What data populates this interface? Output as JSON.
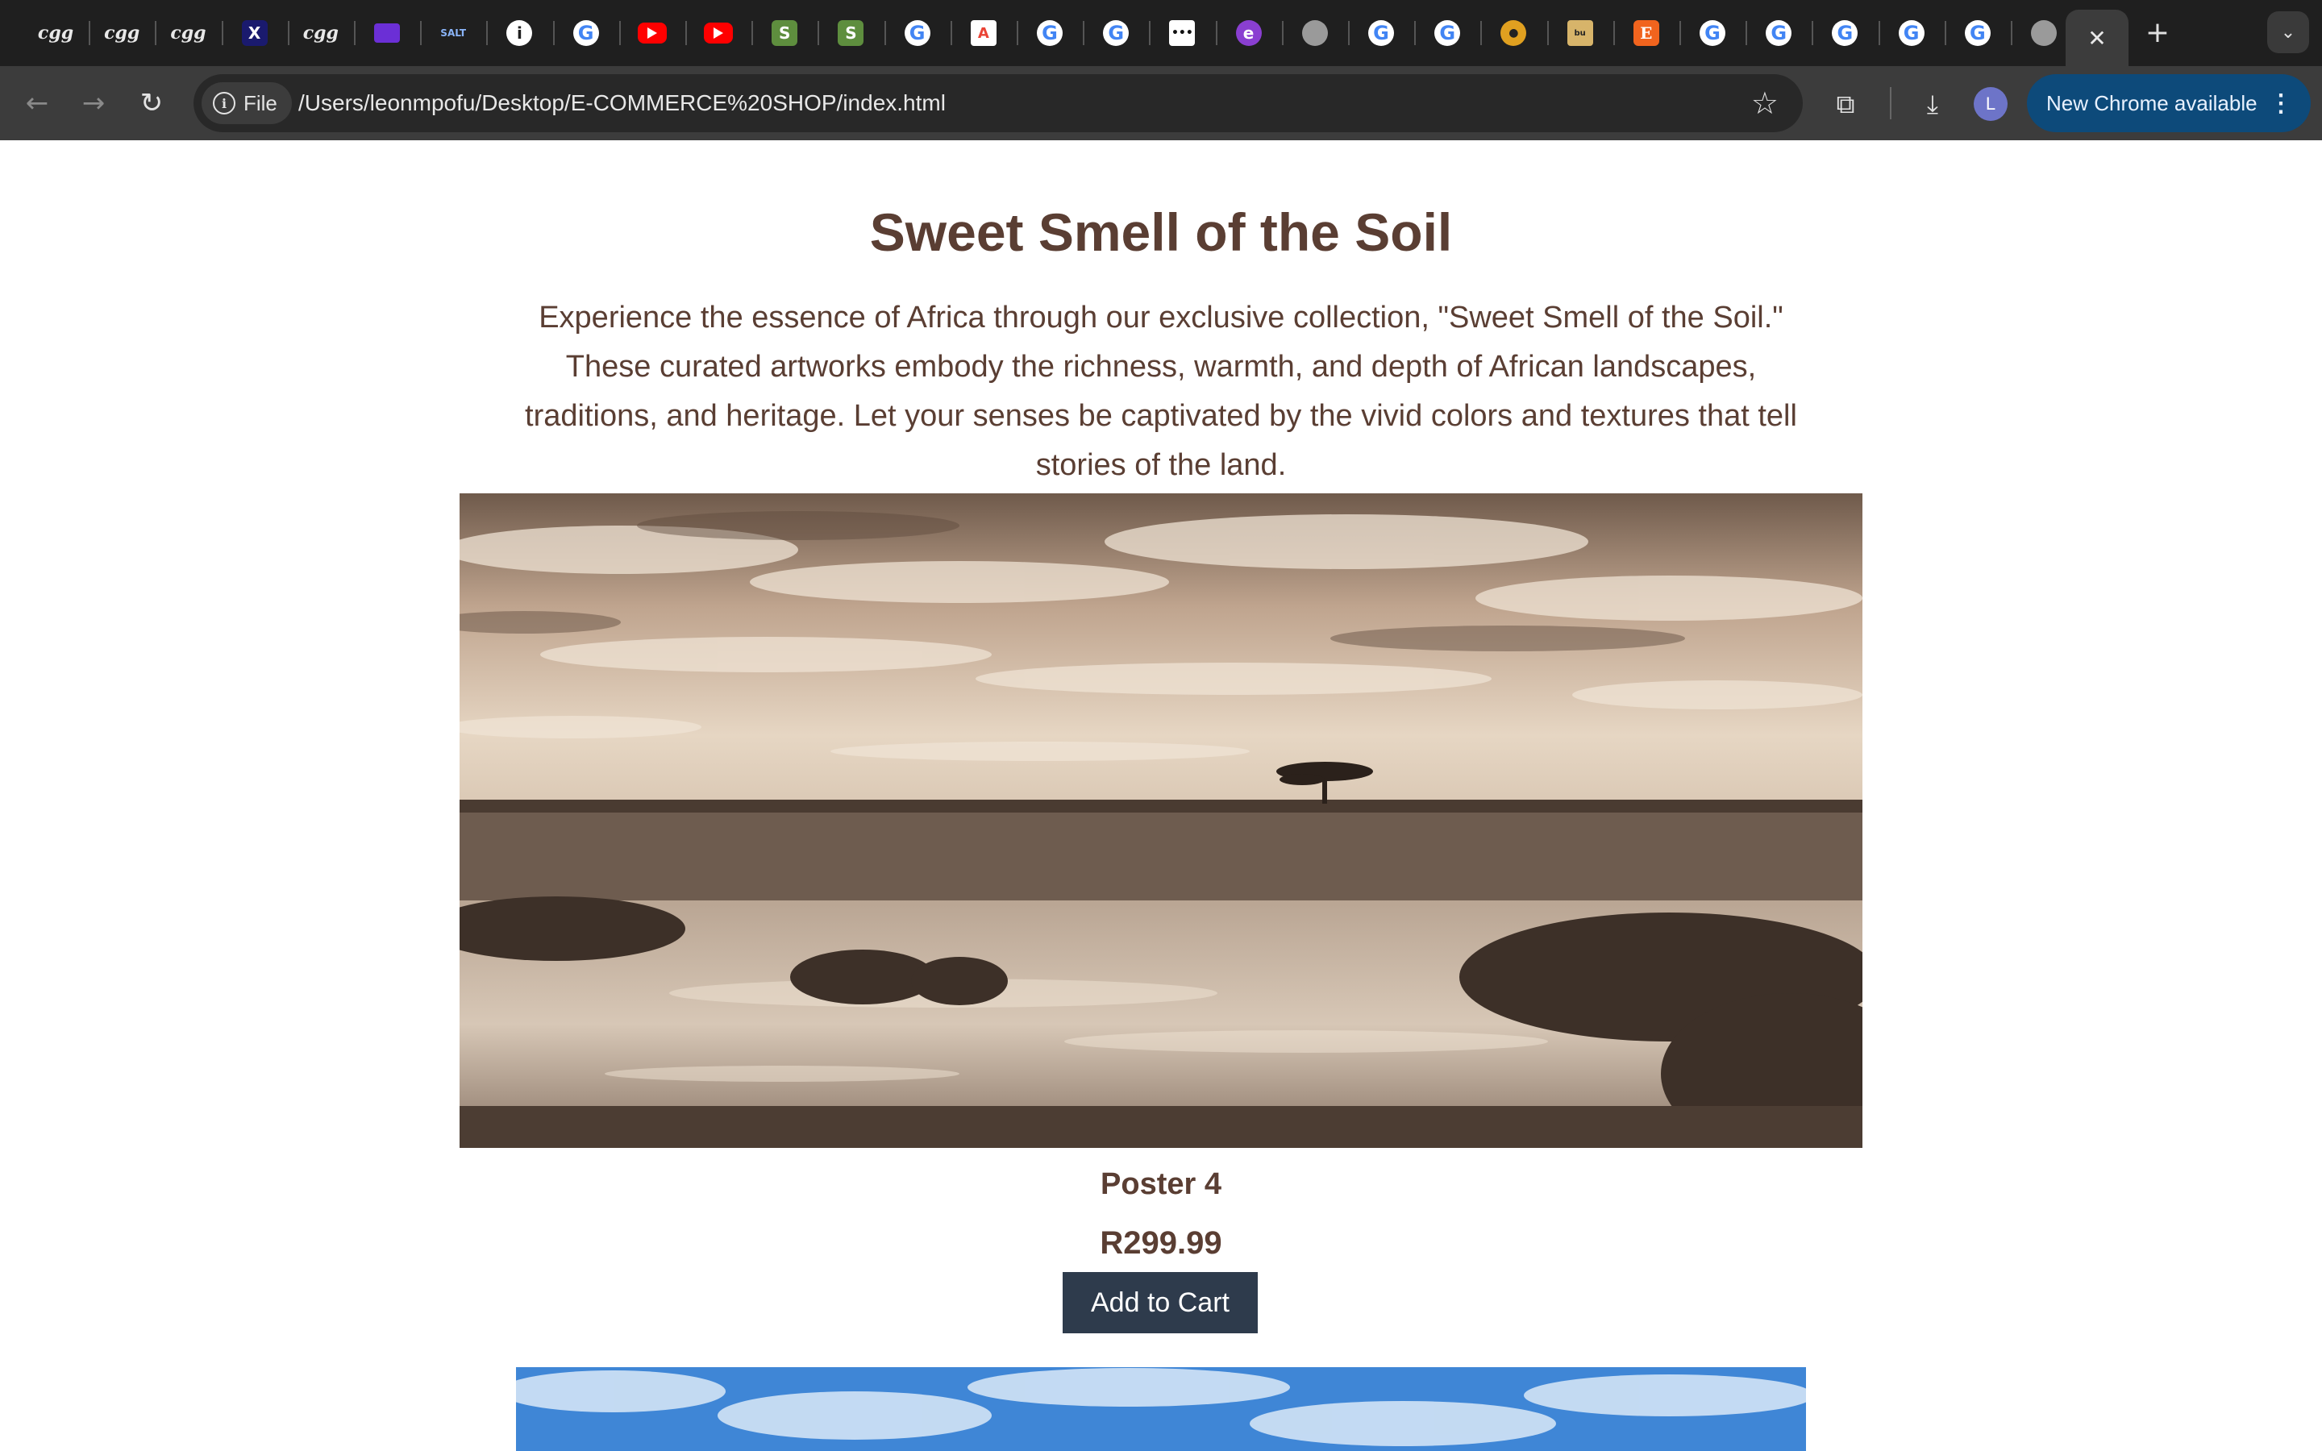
{
  "browser": {
    "tabs": [
      {
        "icon": "cgg-icon",
        "glyph": "cgg"
      },
      {
        "icon": "cgg-icon",
        "glyph": "cgg"
      },
      {
        "icon": "cgg-icon",
        "glyph": "cgg"
      },
      {
        "icon": "x-icon",
        "glyph": "X"
      },
      {
        "icon": "cgg-icon",
        "glyph": "cgg"
      },
      {
        "icon": "mail-icon",
        "glyph": ""
      },
      {
        "icon": "salt-icon",
        "glyph": "SALT"
      },
      {
        "icon": "info-icon",
        "glyph": "i"
      },
      {
        "icon": "google-icon",
        "glyph": "G"
      },
      {
        "icon": "youtube-icon",
        "glyph": ""
      },
      {
        "icon": "youtube-icon",
        "glyph": ""
      },
      {
        "icon": "shopify-icon",
        "glyph": "S"
      },
      {
        "icon": "shopify-icon",
        "glyph": "S"
      },
      {
        "icon": "google-icon",
        "glyph": "G"
      },
      {
        "icon": "ms-icon",
        "glyph": "A"
      },
      {
        "icon": "google-icon",
        "glyph": "G"
      },
      {
        "icon": "google-icon",
        "glyph": "G"
      },
      {
        "icon": "dots-icon",
        "glyph": "•••"
      },
      {
        "icon": "purple-icon",
        "glyph": "e"
      },
      {
        "icon": "globe-icon",
        "glyph": ""
      },
      {
        "icon": "google-icon",
        "glyph": "G"
      },
      {
        "icon": "google-icon",
        "glyph": "G"
      },
      {
        "icon": "amber-icon",
        "glyph": "●"
      },
      {
        "icon": "doc-icon",
        "glyph": "bu"
      },
      {
        "icon": "etsy-icon",
        "glyph": "E"
      },
      {
        "icon": "google-icon",
        "glyph": "G"
      },
      {
        "icon": "google-icon",
        "glyph": "G"
      },
      {
        "icon": "google-icon",
        "glyph": "G"
      },
      {
        "icon": "google-icon",
        "glyph": "G"
      },
      {
        "icon": "google-icon",
        "glyph": "G"
      },
      {
        "icon": "globe-icon",
        "glyph": ""
      }
    ],
    "active_tab_close": "✕",
    "new_tab": "+",
    "tab_menu": "⌄",
    "back": "←",
    "forward": "→",
    "reload": "↻",
    "chip_label": "File",
    "url": "/Users/leonmpofu/Desktop/E-COMMERCE%20SHOP/index.html",
    "bookmark_star": "☆",
    "extensions": "⧉",
    "download": "⤓",
    "avatar_letter": "L",
    "update_label": "New Chrome available",
    "update_menu": "⋮"
  },
  "page": {
    "title": "Sweet Smell of the Soil",
    "intro": "Experience the essence of Africa through our exclusive collection, \"Sweet Smell of the Soil.\" These curated artworks embody the richness, warmth, and depth of African landscapes, traditions, and heritage. Let your senses be captivated by the vivid colors and textures that tell stories of the land.",
    "products": [
      {
        "name": "Poster 4",
        "price": "R299.99",
        "button": "Add to Cart"
      }
    ]
  },
  "colors": {
    "heading": "#5a3e33",
    "button_bg": "#2e3b4c",
    "update_pill": "#0d4a7a",
    "tabstrip": "#1f1f1f",
    "toolbar": "#3c3c3c"
  }
}
